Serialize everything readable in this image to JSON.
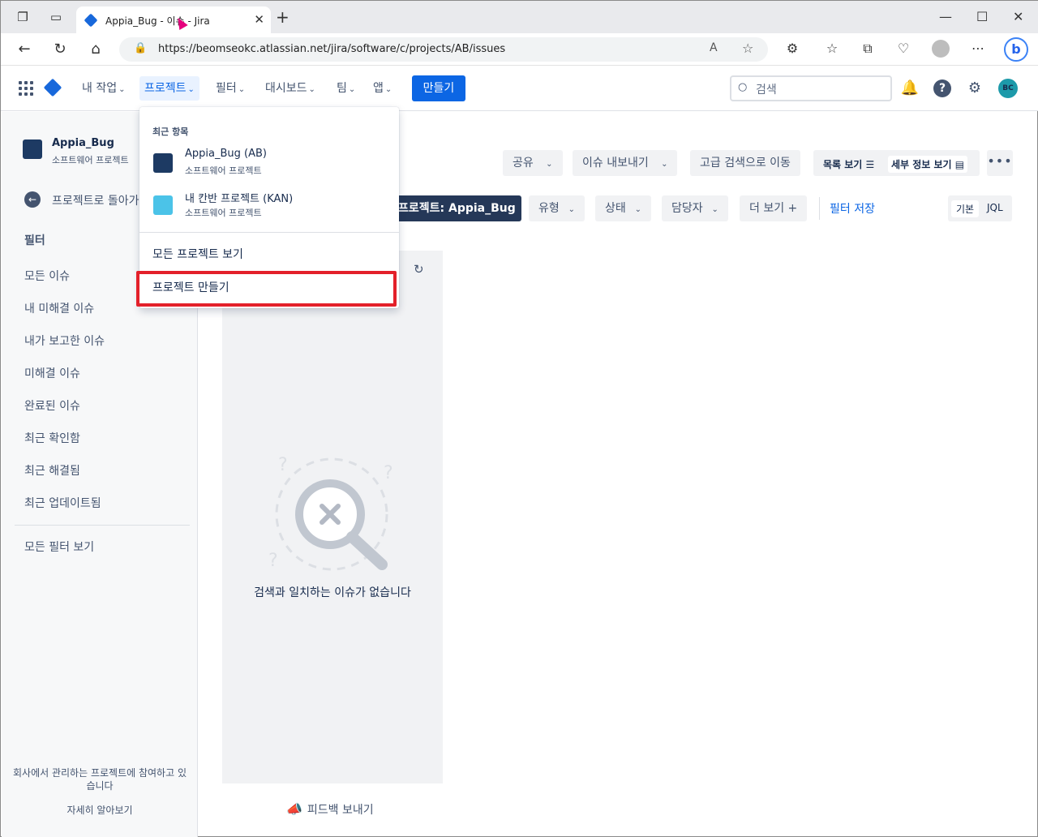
{
  "browser": {
    "tab_title": "Appia_Bug - 이슈 - Jira",
    "url": "https://beomseokc.atlassian.net/jira/software/c/projects/AB/issues",
    "profile_initial": "b"
  },
  "nav": {
    "menus": [
      "내 작업",
      "프로젝트",
      "필터",
      "대시보드",
      "팀",
      "앱"
    ],
    "create_label": "만들기",
    "search_placeholder": "검색",
    "avatar_initials": "BC",
    "accent": "#0c66e4"
  },
  "sidebar": {
    "project_name": "Appia_Bug",
    "project_type": "소프트웨어 프로젝트",
    "back_label": "프로젝트로 돌아가기",
    "filter_heading": "필터",
    "items": [
      "모든 이슈",
      "내 미해결 이슈",
      "내가 보고한 이슈",
      "미해결 이슈",
      "완료된 이슈",
      "최근 확인함",
      "최근 해결됨",
      "최근 업데이트됨"
    ],
    "all_filters": "모든 필터 보기",
    "footer_text": "회사에서 관리하는 프로젝트에 참여하고 있습니다",
    "footer_link": "자세히 알아보기"
  },
  "toolbar": {
    "share": "공유",
    "export": "이슈 내보내기",
    "advanced": "고급 검색으로 이동",
    "list_view": "목록 보기",
    "detail_view": "세부 정보 보기"
  },
  "filters": {
    "project": "프로젝트: Appia_Bug",
    "type": "유형",
    "status": "상태",
    "assignee": "담당자",
    "more": "더 보기",
    "save": "필터 저장",
    "mode_basic": "기본",
    "mode_jql": "JQL"
  },
  "results": {
    "empty_text": "검색과 일치하는 이슈가 없습니다",
    "feedback": "피드백 보내기"
  },
  "dropdown": {
    "recent_heading": "최근 항목",
    "projects": [
      {
        "name": "Appia_Bug (AB)",
        "type": "소프트웨어 프로젝트"
      },
      {
        "name": "내 칸반 프로젝트 (KAN)",
        "type": "소프트웨어 프로젝트"
      }
    ],
    "view_all": "모든 프로젝트 보기",
    "create_project": "프로젝트 만들기",
    "highlight_color": "#e3202a"
  }
}
